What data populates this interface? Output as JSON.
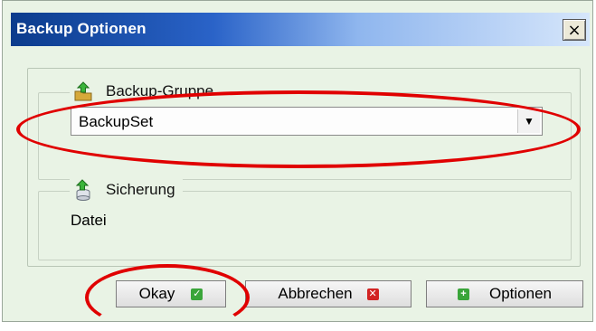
{
  "window": {
    "title": "Backup Optionen",
    "close_glyph": "×"
  },
  "groups": {
    "backup_group": {
      "label": "Backup-Gruppe",
      "icon": "folder-arrow-icon",
      "selected_value": "BackupSet",
      "arrow_glyph": "▼"
    },
    "backup": {
      "label": "Sicherung",
      "icon": "database-arrow-icon",
      "value": "Datei"
    }
  },
  "buttons": {
    "ok": {
      "label": "Okay",
      "icon": "check-icon",
      "icon_color": "#3aa53a"
    },
    "cancel": {
      "label": "Abbrechen",
      "icon": "x-icon",
      "icon_color": "#d22222"
    },
    "options": {
      "label": "Optionen",
      "icon": "plus-icon",
      "icon_color": "#3aa53a"
    }
  },
  "colors": {
    "titlebar_start": "#0b3b8c",
    "titlebar_end": "#d6e6fb",
    "dialog_bg": "#e9f3e5",
    "annotation": "#e00000"
  }
}
